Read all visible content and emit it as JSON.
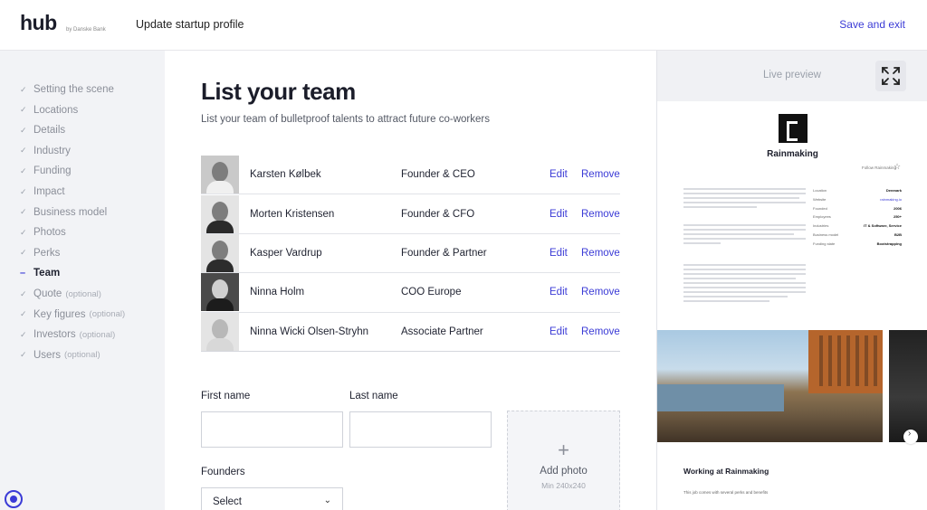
{
  "header": {
    "logo": "hub",
    "logo_sub": "by Danske Bank",
    "title": "Update startup profile",
    "save_exit": "Save and exit"
  },
  "sidebar": {
    "items": [
      {
        "label": "Setting the scene",
        "optional": ""
      },
      {
        "label": "Locations",
        "optional": ""
      },
      {
        "label": "Details",
        "optional": ""
      },
      {
        "label": "Industry",
        "optional": ""
      },
      {
        "label": "Funding",
        "optional": ""
      },
      {
        "label": "Impact",
        "optional": ""
      },
      {
        "label": "Business model",
        "optional": ""
      },
      {
        "label": "Photos",
        "optional": ""
      },
      {
        "label": "Perks",
        "optional": ""
      },
      {
        "label": "Team",
        "optional": ""
      },
      {
        "label": "Quote",
        "optional": "(optional)"
      },
      {
        "label": "Key figures",
        "optional": "(optional)"
      },
      {
        "label": "Investors",
        "optional": "(optional)"
      },
      {
        "label": "Users",
        "optional": "(optional)"
      }
    ],
    "active": "Team"
  },
  "main": {
    "title": "List your team",
    "subtitle": "List your team of bulletproof talents to attract future co-workers",
    "edit_label": "Edit",
    "remove_label": "Remove",
    "team": [
      {
        "name": "Karsten Kølbek",
        "role": "Founder & CEO"
      },
      {
        "name": "Morten Kristensen",
        "role": "Founder & CFO"
      },
      {
        "name": "Kasper Vardrup",
        "role": "Founder & Partner"
      },
      {
        "name": "Ninna Holm",
        "role": "COO Europe"
      },
      {
        "name": "Ninna Wicki Olsen-Stryhn",
        "role": "Associate Partner"
      }
    ],
    "form": {
      "first_name_label": "First name",
      "first_name_value": "",
      "last_name_label": "Last name",
      "last_name_value": "",
      "founders_label": "Founders",
      "founders_value": "Select",
      "add_photo_label": "Add photo",
      "add_photo_hint": "Min 240x240"
    }
  },
  "preview": {
    "label": "Live preview",
    "company_name": "Rainmaking",
    "follow_label": "Follow Rainmaking",
    "facts": [
      {
        "key": "Location",
        "value": "Denmark"
      },
      {
        "key": "Website",
        "value": "rainmaking.io"
      },
      {
        "key": "Founded",
        "value": "2006"
      },
      {
        "key": "Employees",
        "value": "250+"
      },
      {
        "key": "Industries",
        "value": "IT & Software, Service"
      },
      {
        "key": "Business model",
        "value": "B2B"
      },
      {
        "key": "Funding state",
        "value": "Bootstrapping"
      }
    ],
    "work_title": "Working at Rainmaking",
    "work_sub": "This job comes with several perks and benefits"
  },
  "colors": {
    "accent": "#3b3bd6",
    "sidebar_bg": "#f2f3f6",
    "text": "#1f2230"
  }
}
